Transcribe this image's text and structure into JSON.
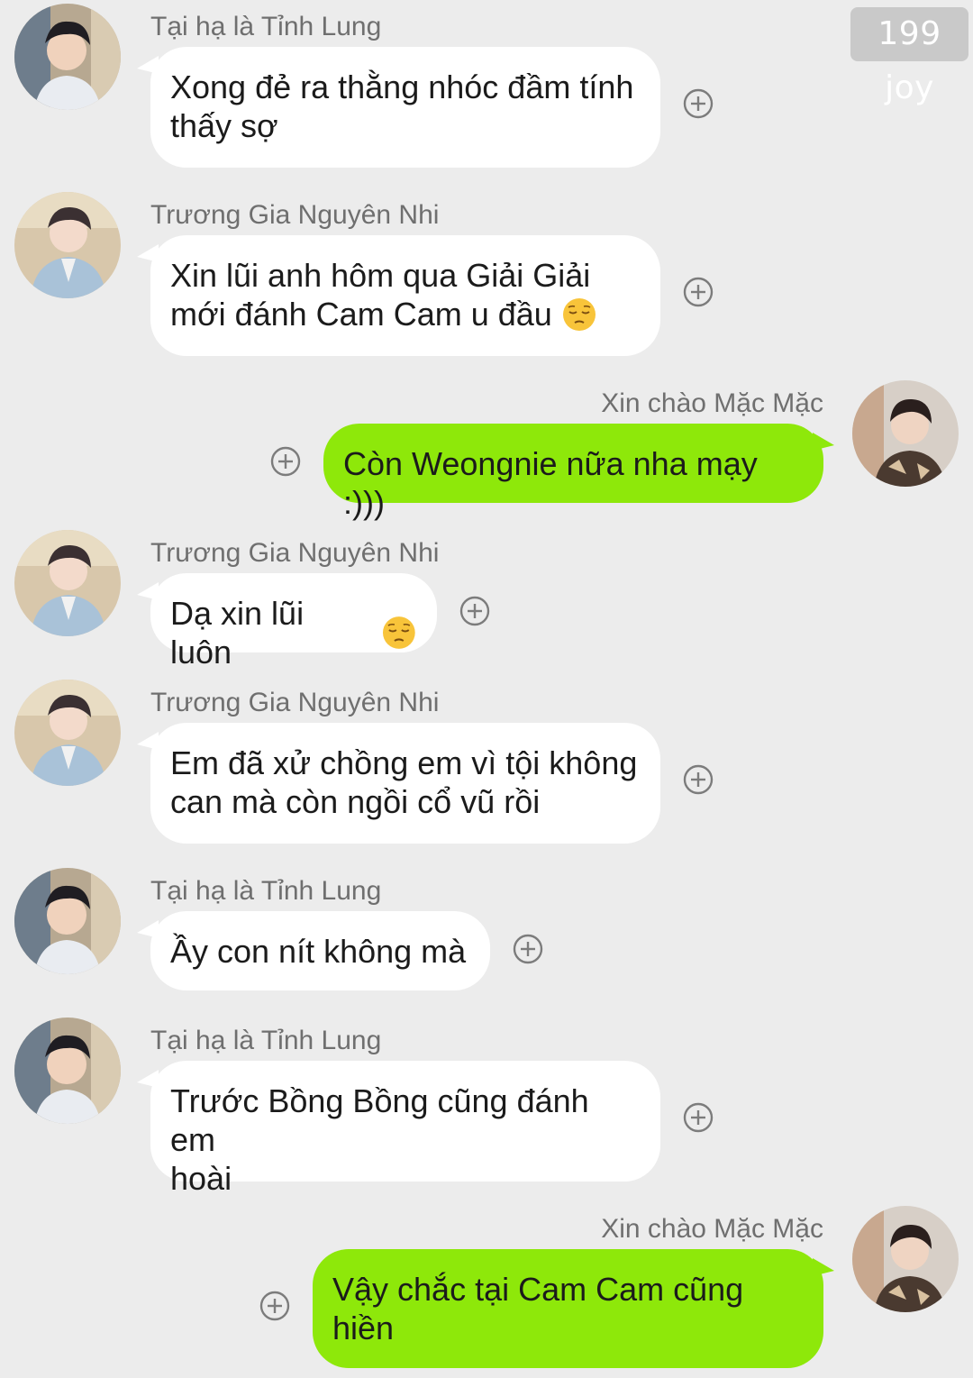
{
  "watermark": "199 joy",
  "icons": {
    "add_reaction": "plus-circle-icon",
    "emoji": "pensive-face-emoji"
  },
  "colors": {
    "background": "#ececec",
    "incoming_bubble": "#ffffff",
    "outgoing_bubble": "#8ee80a",
    "sender_text": "#6f6f6f",
    "message_text": "#1b1b1b"
  },
  "messages": [
    {
      "sender": "Tại hạ là Tỉnh Lung",
      "direction": "incoming",
      "lines": [
        "Xong đẻ ra thằng nhóc đầm tính",
        "thấy sợ"
      ]
    },
    {
      "sender": "Trương Gia Nguyên Nhi",
      "direction": "incoming",
      "lines": [
        "Xin lũi anh hôm qua Giải Giải",
        "mới đánh Cam Cam u đầu"
      ],
      "emoji_after_line": 2
    },
    {
      "sender": "Xin chào Mặc Mặc",
      "direction": "outgoing",
      "lines": [
        "Còn Weongnie nữa nha mạy :)))"
      ]
    },
    {
      "sender": "Trương Gia Nguyên Nhi",
      "direction": "incoming",
      "lines": [
        "Dạ xin lũi luôn"
      ],
      "emoji_after_line": 1
    },
    {
      "sender": "Trương Gia Nguyên Nhi",
      "direction": "incoming",
      "lines": [
        "Em đã xử chồng em vì tội không",
        "can mà còn ngồi cổ vũ rồi"
      ]
    },
    {
      "sender": "Tại hạ là Tỉnh Lung",
      "direction": "incoming",
      "lines": [
        "Ầy con nít không mà"
      ]
    },
    {
      "sender": "Tại hạ là Tỉnh Lung",
      "direction": "incoming",
      "lines": [
        "Trước Bồng Bồng cũng đánh em",
        "hoài"
      ]
    },
    {
      "sender": "Xin chào Mặc Mặc",
      "direction": "outgoing",
      "lines": [
        "Vậy chắc tại Cam Cam cũng",
        "hiền"
      ]
    }
  ]
}
